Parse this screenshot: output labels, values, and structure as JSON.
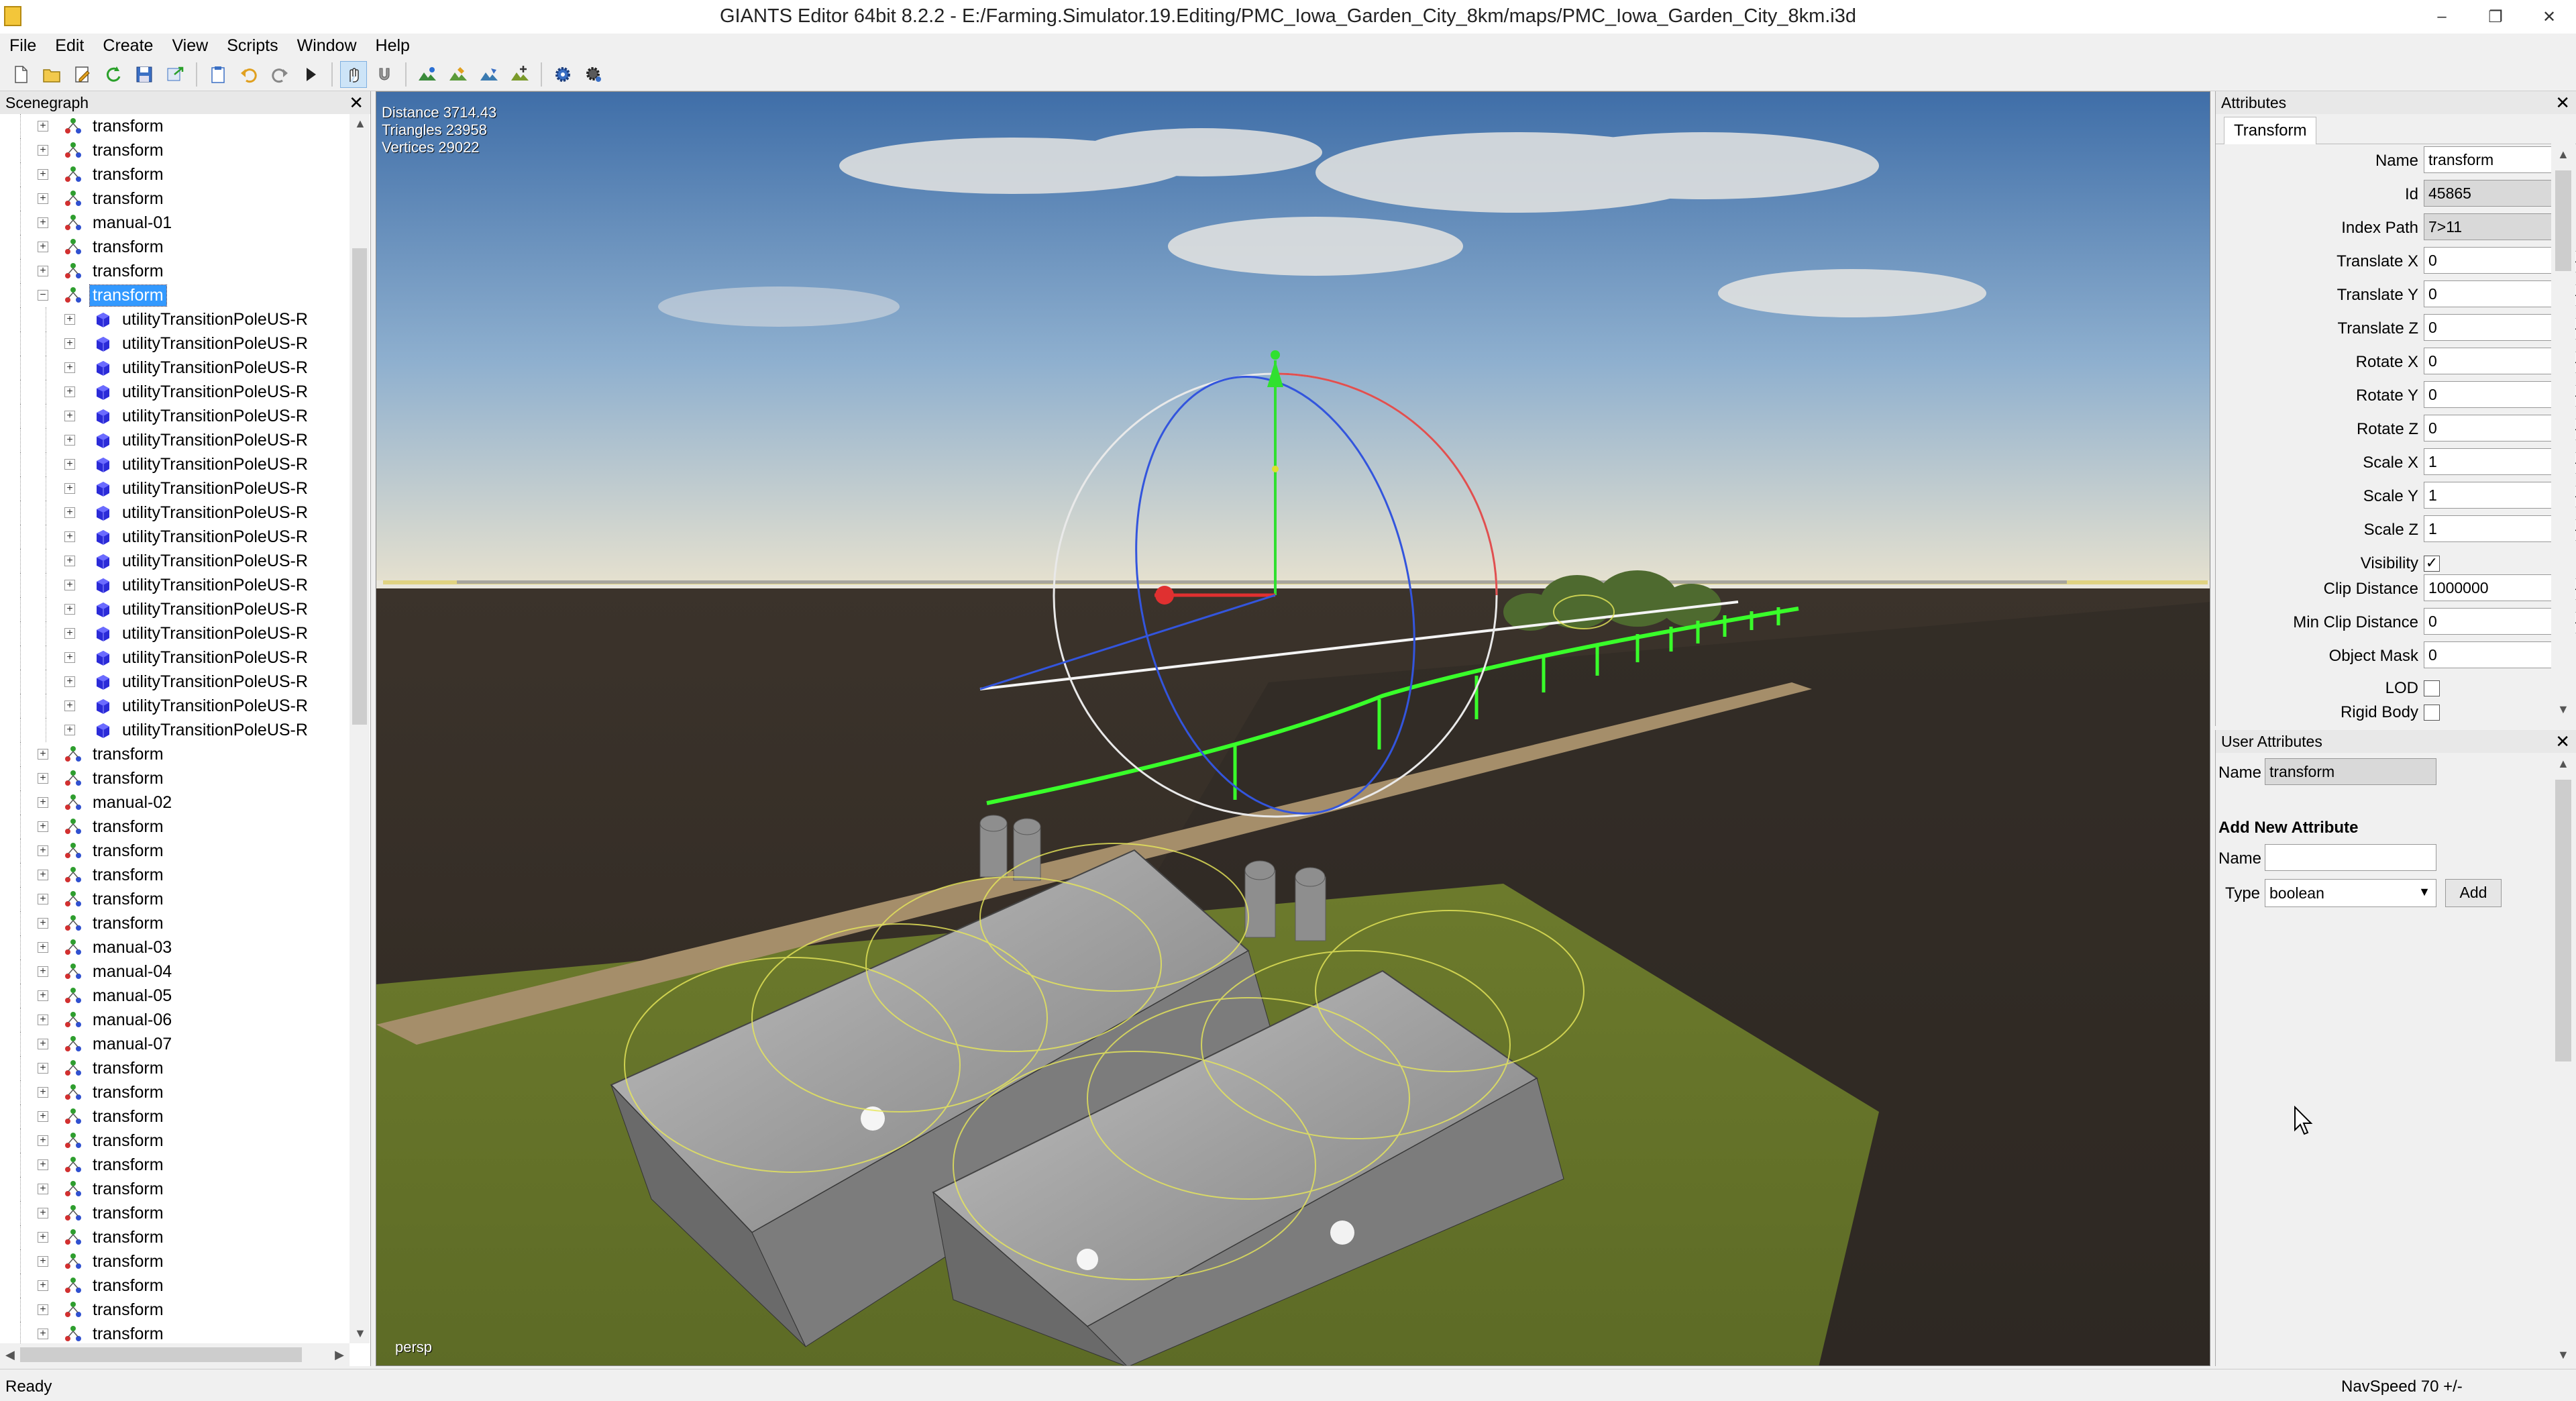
{
  "window": {
    "title": "GIANTS Editor 64bit 8.2.2 - E:/Farming.Simulator.19.Editing/PMC_Iowa_Garden_City_8km/maps/PMC_Iowa_Garden_City_8km.i3d",
    "minimize": "–",
    "maximize": "❐",
    "close": "✕"
  },
  "menu": [
    "File",
    "Edit",
    "Create",
    "View",
    "Scripts",
    "Window",
    "Help"
  ],
  "scenegraph": {
    "title": "Scenegraph",
    "close": "✕",
    "items": [
      {
        "label": "transform",
        "kind": "transform",
        "depth": 1
      },
      {
        "label": "transform",
        "kind": "transform",
        "depth": 1
      },
      {
        "label": "transform",
        "kind": "transform",
        "depth": 1
      },
      {
        "label": "transform",
        "kind": "transform",
        "depth": 1
      },
      {
        "label": "manual-01",
        "kind": "transform",
        "depth": 1
      },
      {
        "label": "transform",
        "kind": "transform",
        "depth": 1
      },
      {
        "label": "transform",
        "kind": "transform",
        "depth": 1
      },
      {
        "label": "transform",
        "kind": "transform",
        "depth": 1,
        "selected": true,
        "expanded": true
      },
      {
        "label": "utilityTransitionPoleUS-R",
        "kind": "mesh",
        "depth": 2
      },
      {
        "label": "utilityTransitionPoleUS-R",
        "kind": "mesh",
        "depth": 2
      },
      {
        "label": "utilityTransitionPoleUS-R",
        "kind": "mesh",
        "depth": 2
      },
      {
        "label": "utilityTransitionPoleUS-R",
        "kind": "mesh",
        "depth": 2
      },
      {
        "label": "utilityTransitionPoleUS-R",
        "kind": "mesh",
        "depth": 2
      },
      {
        "label": "utilityTransitionPoleUS-R",
        "kind": "mesh",
        "depth": 2
      },
      {
        "label": "utilityTransitionPoleUS-R",
        "kind": "mesh",
        "depth": 2
      },
      {
        "label": "utilityTransitionPoleUS-R",
        "kind": "mesh",
        "depth": 2
      },
      {
        "label": "utilityTransitionPoleUS-R",
        "kind": "mesh",
        "depth": 2
      },
      {
        "label": "utilityTransitionPoleUS-R",
        "kind": "mesh",
        "depth": 2
      },
      {
        "label": "utilityTransitionPoleUS-R",
        "kind": "mesh",
        "depth": 2
      },
      {
        "label": "utilityTransitionPoleUS-R",
        "kind": "mesh",
        "depth": 2
      },
      {
        "label": "utilityTransitionPoleUS-R",
        "kind": "mesh",
        "depth": 2
      },
      {
        "label": "utilityTransitionPoleUS-R",
        "kind": "mesh",
        "depth": 2
      },
      {
        "label": "utilityTransitionPoleUS-R",
        "kind": "mesh",
        "depth": 2
      },
      {
        "label": "utilityTransitionPoleUS-R",
        "kind": "mesh",
        "depth": 2
      },
      {
        "label": "utilityTransitionPoleUS-R",
        "kind": "mesh",
        "depth": 2
      },
      {
        "label": "utilityTransitionPoleUS-R",
        "kind": "mesh",
        "depth": 2
      },
      {
        "label": "transform",
        "kind": "transform",
        "depth": 1
      },
      {
        "label": "transform",
        "kind": "transform",
        "depth": 1
      },
      {
        "label": "manual-02",
        "kind": "transform",
        "depth": 1
      },
      {
        "label": "transform",
        "kind": "transform",
        "depth": 1
      },
      {
        "label": "transform",
        "kind": "transform",
        "depth": 1
      },
      {
        "label": "transform",
        "kind": "transform",
        "depth": 1
      },
      {
        "label": "transform",
        "kind": "transform",
        "depth": 1
      },
      {
        "label": "transform",
        "kind": "transform",
        "depth": 1
      },
      {
        "label": "manual-03",
        "kind": "transform",
        "depth": 1
      },
      {
        "label": "manual-04",
        "kind": "transform",
        "depth": 1
      },
      {
        "label": "manual-05",
        "kind": "transform",
        "depth": 1
      },
      {
        "label": "manual-06",
        "kind": "transform",
        "depth": 1
      },
      {
        "label": "manual-07",
        "kind": "transform",
        "depth": 1
      },
      {
        "label": "transform",
        "kind": "transform",
        "depth": 1
      },
      {
        "label": "transform",
        "kind": "transform",
        "depth": 1
      },
      {
        "label": "transform",
        "kind": "transform",
        "depth": 1
      },
      {
        "label": "transform",
        "kind": "transform",
        "depth": 1
      },
      {
        "label": "transform",
        "kind": "transform",
        "depth": 1
      },
      {
        "label": "transform",
        "kind": "transform",
        "depth": 1
      },
      {
        "label": "transform",
        "kind": "transform",
        "depth": 1
      },
      {
        "label": "transform",
        "kind": "transform",
        "depth": 1
      },
      {
        "label": "transform",
        "kind": "transform",
        "depth": 1
      },
      {
        "label": "transform",
        "kind": "transform",
        "depth": 1
      },
      {
        "label": "transform",
        "kind": "transform",
        "depth": 1
      },
      {
        "label": "transform",
        "kind": "transform",
        "depth": 1
      }
    ]
  },
  "viewport": {
    "distance": "Distance 3714.43",
    "triangles": "Triangles 23958",
    "vertices": "Vertices 29022",
    "camera": "persp"
  },
  "attributes": {
    "title": "Attributes",
    "close": "✕",
    "tab": "Transform",
    "fields": [
      {
        "label": "Name",
        "value": "transform",
        "type": "text"
      },
      {
        "label": "Id",
        "value": "45865",
        "type": "readonly"
      },
      {
        "label": "Index Path",
        "value": "7>11",
        "type": "readonly"
      },
      {
        "label": "Translate X",
        "value": "0",
        "type": "spin"
      },
      {
        "label": "Translate Y",
        "value": "0",
        "type": "spin"
      },
      {
        "label": "Translate Z",
        "value": "0",
        "type": "spin"
      },
      {
        "label": "Rotate X",
        "value": "0",
        "type": "spin"
      },
      {
        "label": "Rotate Y",
        "value": "0",
        "type": "spin"
      },
      {
        "label": "Rotate Z",
        "value": "0",
        "type": "spin"
      },
      {
        "label": "Scale X",
        "value": "1",
        "type": "spin"
      },
      {
        "label": "Scale Y",
        "value": "1",
        "type": "spin"
      },
      {
        "label": "Scale Z",
        "value": "1",
        "type": "spin"
      },
      {
        "label": "Visibility",
        "value": "✓",
        "type": "check"
      },
      {
        "label": "Clip Distance",
        "value": "1000000",
        "type": "spin"
      },
      {
        "label": "Min Clip Distance",
        "value": "0",
        "type": "spin"
      },
      {
        "label": "Object Mask",
        "value": "0",
        "type": "dots"
      },
      {
        "label": "LOD",
        "value": "",
        "type": "check"
      },
      {
        "label": "Rigid Body",
        "value": "",
        "type": "check"
      }
    ],
    "spin_glyph": "◂▸",
    "dots_glyph": "..."
  },
  "user_attributes": {
    "title": "User Attributes",
    "close": "✕",
    "name_label": "Name",
    "name_value": "transform",
    "add_title": "Add New Attribute",
    "new_name_label": "Name",
    "new_name_value": "",
    "type_label": "Type",
    "type_value": "boolean",
    "add_button": "Add"
  },
  "status": {
    "left": "Ready",
    "right": "NavSpeed 70 +/-"
  },
  "colors": {
    "selection": "#3399ff",
    "mesh_icon": "#2b2bd8",
    "gizmo_green": "#30e030",
    "power_line": "#39ff2a"
  }
}
